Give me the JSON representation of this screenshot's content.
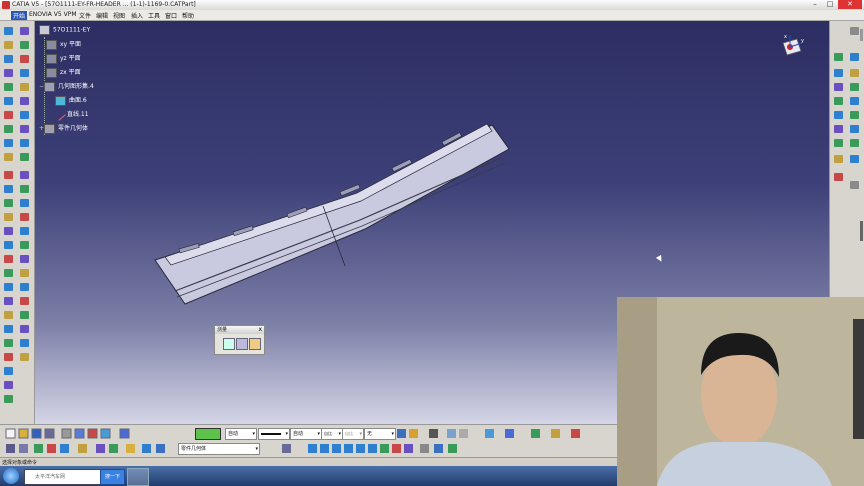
{
  "window": {
    "title": "CATIA V5 - [57O1111-EY-FR-HEADER ... (1-1)-1169-0.CATPart]"
  },
  "menubar": {
    "items": [
      "开始",
      "ENOVIA V5 VPM",
      "文件",
      "编辑",
      "视图",
      "插入",
      "工具",
      "窗口",
      "帮助"
    ]
  },
  "tree": {
    "root": "57O1111-EY",
    "nodes": [
      {
        "label": "xy 平面",
        "icon": "plane-icon"
      },
      {
        "label": "yz 平面",
        "icon": "plane-icon"
      },
      {
        "label": "zx 平面",
        "icon": "plane-icon"
      },
      {
        "label": "几何图形集.4",
        "icon": "geometric-set-icon"
      },
      {
        "label": "曲面.6",
        "icon": "surface-icon"
      },
      {
        "label": "直线.11",
        "icon": "line-icon"
      },
      {
        "label": "零件几何体",
        "icon": "body-icon"
      }
    ]
  },
  "compass": {
    "x_label": "x",
    "y_label": "y"
  },
  "measure_panel": {
    "title": "测量",
    "close": "x"
  },
  "bottom_toolbar": {
    "color_value": "#5cc24a",
    "transparency": "自动",
    "linetype": "自动",
    "lineweight": "自动",
    "thickness": "自动",
    "layer": "无",
    "current_body": "零件几何体"
  },
  "status": {
    "text": "选择对象或命令"
  },
  "taskbar": {
    "search_placeholder": "太平洋汽车网",
    "search_button": "搜一下"
  },
  "colors": {
    "viewport_top": "#2c2e62",
    "viewport_bottom": "#d4d5e6",
    "part_face": "#c9cae0"
  }
}
